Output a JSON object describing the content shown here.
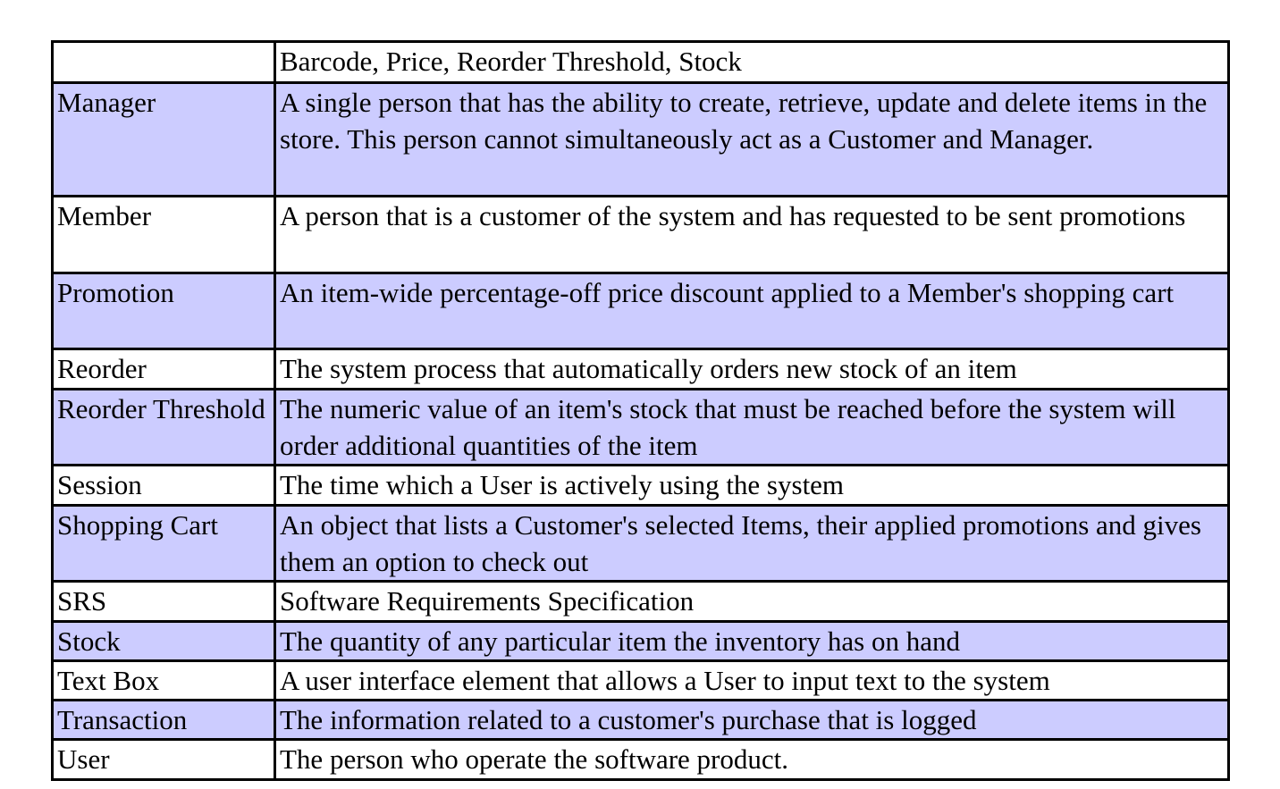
{
  "header": {
    "term": "",
    "definition": "Barcode, Price, Reorder Threshold, Stock"
  },
  "rows": [
    {
      "term": "Manager",
      "definition": "A single person that has the ability to create, retrieve, update and delete items in the store. This person cannot simultaneously act as a Customer and Manager."
    },
    {
      "term": "Member",
      "definition": "A person that is a customer of the system and has requested to be sent promotions"
    },
    {
      "term": "Promotion",
      "definition": "An item-wide percentage-off price discount applied to a Member's shopping cart"
    },
    {
      "term": "Reorder",
      "definition": "The system process that automatically orders new stock of an item"
    },
    {
      "term": "Reorder Threshold",
      "definition": "The numeric value of an item's stock that must be reached before the system will order additional quantities of the item"
    },
    {
      "term": "Session",
      "definition": "The time which a User is actively using the system"
    },
    {
      "term": "Shopping Cart",
      "definition": "An object that lists a Customer's selected Items, their applied promotions and gives them an option to check out"
    },
    {
      "term": "SRS",
      "definition": "Software Requirements Specification"
    },
    {
      "term": "Stock",
      "definition": "The quantity of any particular item the inventory has on hand"
    },
    {
      "term": "Text Box",
      "definition": "A user interface element that allows a User to input text to the system"
    },
    {
      "term": "Transaction",
      "definition": "The information related to a customer's purchase that is logged"
    },
    {
      "term": "User",
      "definition": "The person who operate the software product."
    }
  ],
  "colors": {
    "alt_row": "#ccccff",
    "border": "#000000"
  }
}
